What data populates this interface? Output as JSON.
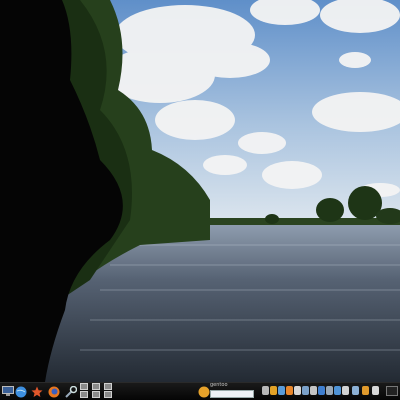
{
  "desktop": {
    "wallpaper_name": "lake-landscape-wallpaper",
    "colors": {
      "sky_top": "#6f9fd6",
      "sky_horizon": "#d9e4ef",
      "cloud": "#f3f3f3",
      "trees": "#1f3a17",
      "water": "#3b4654",
      "shadow": "#050505"
    }
  },
  "taskbar": {
    "launchers": [
      {
        "name": "monitor-icon"
      },
      {
        "name": "globe-icon"
      },
      {
        "name": "star-icon"
      },
      {
        "name": "firefox-icon"
      },
      {
        "name": "tools-icon"
      }
    ],
    "search_label": "gentoo",
    "search_value": "",
    "tray_icons": [
      "volume-icon",
      "network-icon",
      "battery-icon",
      "chat-icon",
      "mail-icon",
      "update-icon",
      "clipboard-icon",
      "bluetooth-icon",
      "printer-icon",
      "sync-icon",
      "calendar-icon",
      "download-icon",
      "shield-icon",
      "display-icon"
    ]
  }
}
